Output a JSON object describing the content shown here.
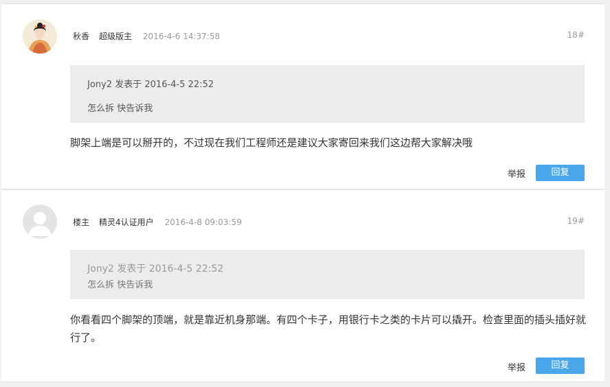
{
  "posts": [
    {
      "author": "秋香",
      "badge": "超级版主",
      "time": "2016-4-6 14:37:58",
      "floor": "18#",
      "quote_header": "Jony2 发表于 2016-4-5 22:52",
      "quote_body": "怎么拆 快告诉我",
      "content": "脚架上端是可以掰开的，不过现在我们工程师还是建议大家寄回来我们这边帮大家解决哦",
      "report_label": "举报",
      "reply_label": "回复"
    },
    {
      "author": "楼主",
      "badge": "精灵4认证用户",
      "time": "2016-4-8 09:03:59",
      "floor": "19#",
      "quote_header": "Jony2 发表于 2016-4-5 22:52",
      "quote_body": "怎么拆 快告诉我",
      "content": "你看看四个脚架的顶端，就是靠近机身那端。有四个卡子，用银行卡之类的卡片可以撬开。检查里面的插头插好就行了。",
      "report_label": "举报",
      "reply_label": "回复"
    }
  ],
  "colors": {
    "reply_button": "#4aa8ea",
    "quote_background": "#ececec",
    "page_background": "#f1f1f1"
  }
}
